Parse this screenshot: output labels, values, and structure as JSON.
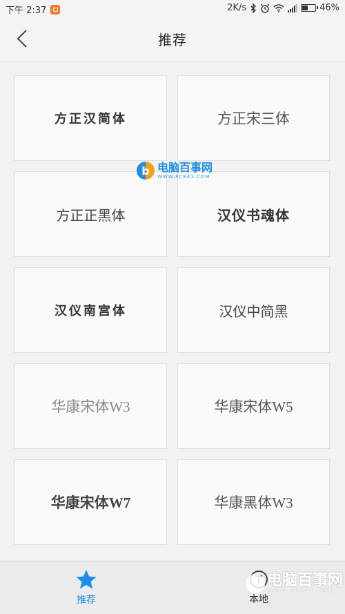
{
  "status_bar": {
    "time": "下午 2:37",
    "net_speed": "2K/s",
    "battery_level": 0.46,
    "battery_text": "46%"
  },
  "nav": {
    "title": "推荐",
    "back_icon": "chevron-left-icon"
  },
  "fonts": [
    {
      "name": "方正汉简体"
    },
    {
      "name": "方正宋三体"
    },
    {
      "name": "方正正黑体"
    },
    {
      "name": "汉仪书魂体"
    },
    {
      "name": "汉仪南宫体"
    },
    {
      "name": "汉仪中简黑"
    },
    {
      "name": "华康宋体W3"
    },
    {
      "name": "华康宋体W5"
    },
    {
      "name": "华康宋体W7"
    },
    {
      "name": "华康黑体W3"
    }
  ],
  "watermark": {
    "logo_letter": "b",
    "name": "电脑百事网",
    "url": "WWW.PC841.COM"
  },
  "bottom_tabs": [
    {
      "label": "推荐",
      "icon": "star-icon",
      "active": true
    },
    {
      "label": "本地",
      "icon": "local-font-icon",
      "active": false
    }
  ],
  "colors": {
    "accent": "#1d8ee8",
    "background": "#f2f2f2",
    "card_border": "#dedede"
  }
}
